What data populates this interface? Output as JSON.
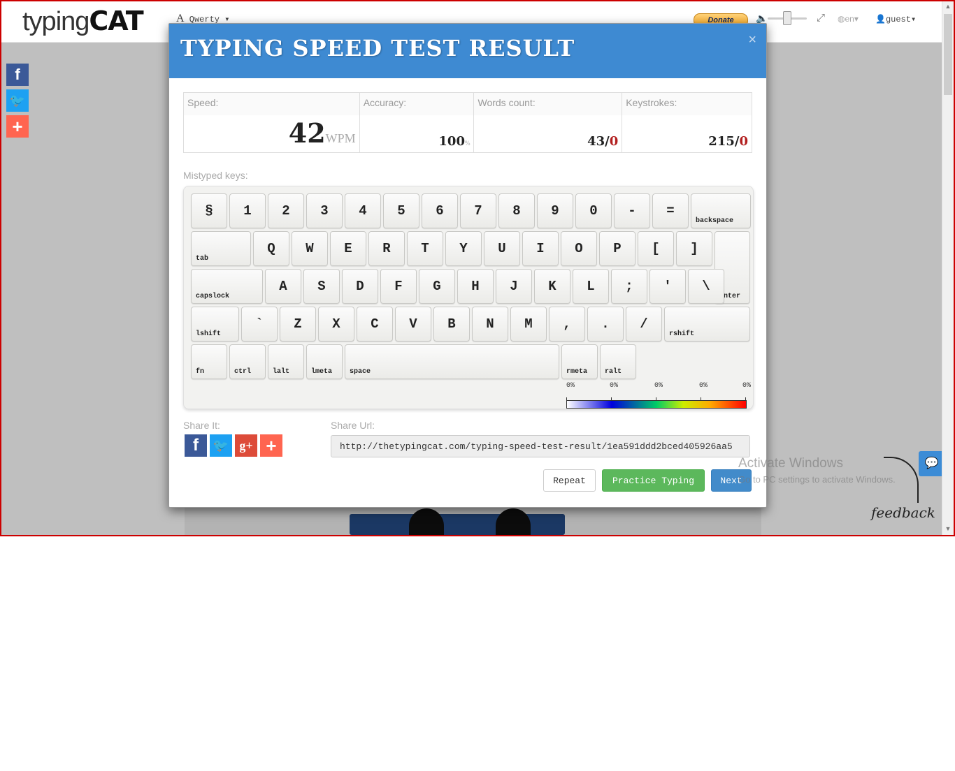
{
  "header": {
    "logo_light": "typing",
    "logo_bold": "CAT",
    "layout_letter": "A",
    "layout_name": "Qwerty",
    "donate": "Donate",
    "language": "en",
    "user": "guest"
  },
  "modal": {
    "title": "TYPING SPEED TEST RESULT",
    "close": "×",
    "stats": {
      "speed_label": "Speed:",
      "speed_value": "42",
      "speed_unit": "WPM",
      "accuracy_label": "Accuracy:",
      "accuracy_value": "100",
      "accuracy_unit": "%",
      "words_label": "Words count:",
      "words_value": "43/",
      "words_errors": "0",
      "keystrokes_label": "Keystrokes:",
      "keystrokes_value": "215/",
      "keystrokes_errors": "0"
    },
    "mistyped_label": "Mistyped keys:",
    "keyboard": {
      "rows": [
        [
          "§",
          "1",
          "2",
          "3",
          "4",
          "5",
          "6",
          "7",
          "8",
          "9",
          "0",
          "-",
          "=",
          "backspace"
        ],
        [
          "tab",
          "Q",
          "W",
          "E",
          "R",
          "T",
          "Y",
          "U",
          "I",
          "O",
          "P",
          "[",
          "]",
          "enter"
        ],
        [
          "capslock",
          "A",
          "S",
          "D",
          "F",
          "G",
          "H",
          "J",
          "K",
          "L",
          ";",
          "'",
          "\\"
        ],
        [
          "lshift",
          "`",
          "Z",
          "X",
          "C",
          "V",
          "B",
          "N",
          "M",
          ",",
          ".",
          "/",
          "rshift"
        ],
        [
          "fn",
          "ctrl",
          "lalt",
          "lmeta",
          "space",
          "rmeta",
          "ralt"
        ]
      ]
    },
    "heatmap": {
      "labels": [
        "0%",
        "0%",
        "0%",
        "0%",
        "0%"
      ]
    },
    "share_label": "Share It:",
    "share_url_label": "Share Url:",
    "share_url": "http://thetypingcat.com/typing-speed-test-result/1ea591ddd2bced405926aa5",
    "buttons": {
      "repeat": "Repeat",
      "practice": "Practice Typing",
      "next": "Next"
    }
  },
  "watermark": {
    "line1": "Activate Windows",
    "line2": "Go to PC settings to activate Windows."
  },
  "feedback": "feedback"
}
